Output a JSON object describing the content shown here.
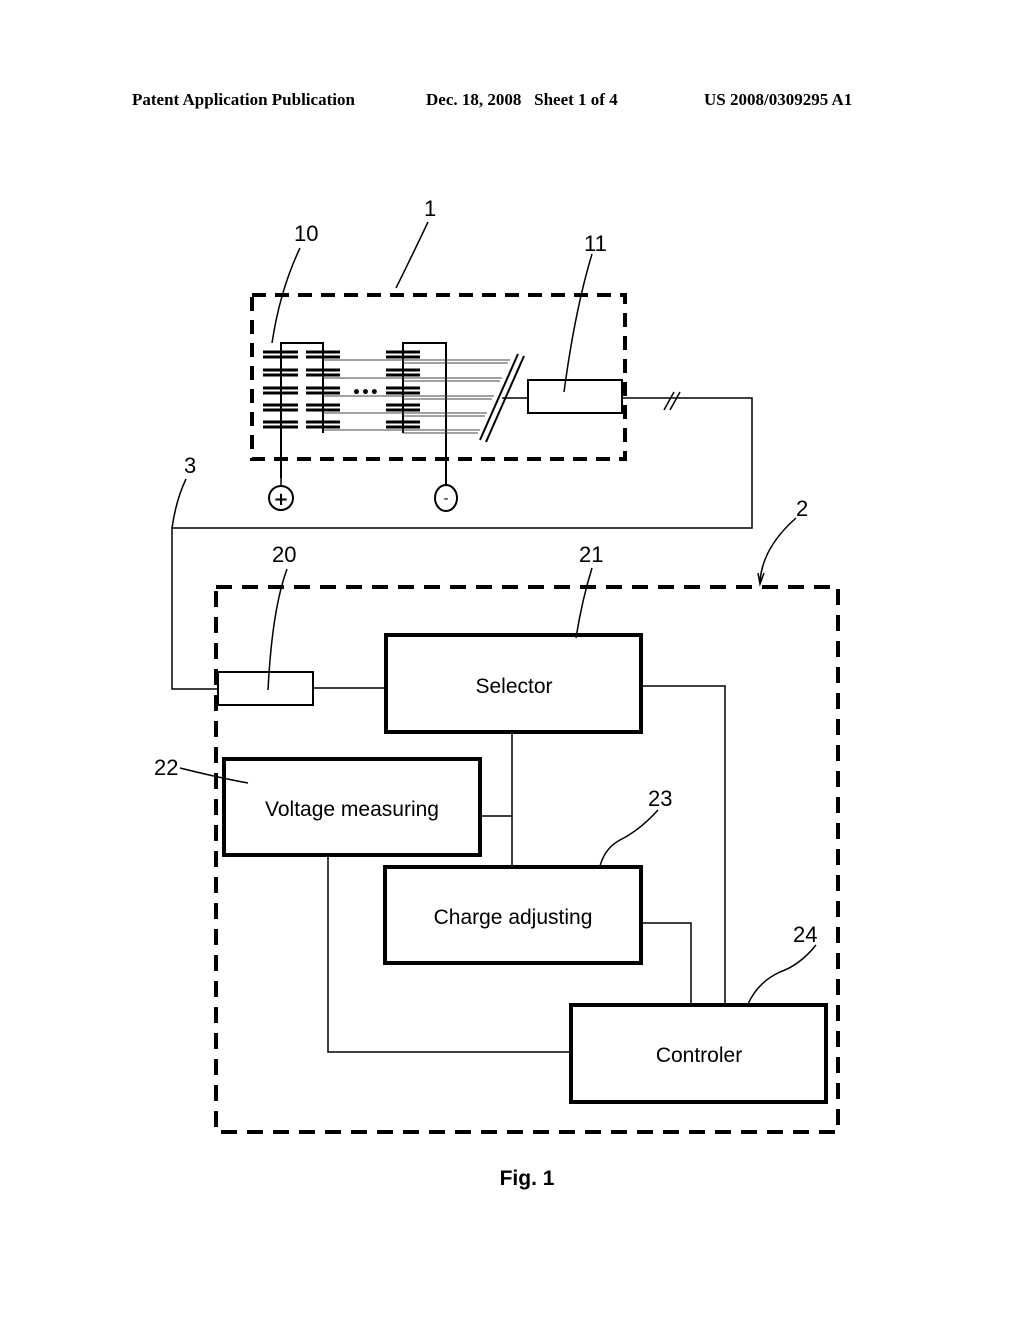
{
  "header": {
    "publication": "Patent Application Publication",
    "date_sheet": "Dec. 18, 2008   Sheet 1 of 4",
    "number": "US 2008/0309295 A1"
  },
  "diagram": {
    "refs": {
      "battery_pack": "1",
      "balancing_device": "2",
      "connection": "3",
      "cell_array": "10",
      "pack_connector": "11",
      "device_connector": "20",
      "selector": "21",
      "voltage_measuring": "22",
      "charge_adjusting": "23",
      "controler": "24"
    },
    "blocks": {
      "selector": "Selector",
      "voltage_measuring": "Voltage measuring",
      "charge_adjusting": "Charge adjusting",
      "controler": "Controler"
    },
    "terminals": {
      "positive": "+",
      "negative": "-"
    },
    "ellipsis": "•••",
    "caption": "Fig. 1"
  }
}
